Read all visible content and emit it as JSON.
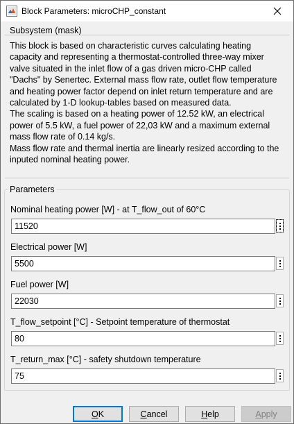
{
  "window": {
    "title": "Block Parameters: microCHP_constant"
  },
  "description": {
    "heading": "Subsystem (mask)",
    "para1": "This block is based on characteristic curves calculating heating capacity and representing a thermostat-controlled three-way mixer valve situated in the inlet flow of a gas driven micro-CHP called \"Dachs\" by Senertec. External mass flow rate, outlet flow temperature and heating power factor depend on inlet return temperature and are calculated by 1-D lookup-tables based on measured data.",
    "para2": "The scaling is based on a heating power of 12.52 kW, an electrical power of 5.5 kW, a fuel power of 22,03 kW and a maximum external mass flow rate of 0.14 kg/s.",
    "para3": "Mass flow rate and thermal inertia are linearly resized according to the inputed nominal heating power."
  },
  "parameters": {
    "legend": "Parameters",
    "items": [
      {
        "label": "Nominal heating power [W] - at T_flow_out of 60°C",
        "value": "11520"
      },
      {
        "label": "Electrical power [W]",
        "value": "5500"
      },
      {
        "label": "Fuel power [W]",
        "value": "22030"
      },
      {
        "label": "T_flow_setpoint [°C] - Setpoint temperature of thermostat",
        "value": "80"
      },
      {
        "label": "T_return_max [°C] - safety shutdown temperature",
        "value": "75"
      }
    ]
  },
  "buttons": {
    "ok": {
      "mnemonic": "O",
      "rest": "K"
    },
    "cancel": {
      "mnemonic": "C",
      "rest": "ancel"
    },
    "help": {
      "mnemonic": "H",
      "rest": "elp"
    },
    "apply": {
      "mnemonic": "A",
      "rest": "pply"
    }
  },
  "icons": {
    "app": "matlab-simulink-icon",
    "close": "close-icon",
    "more": "more-options-icon"
  }
}
